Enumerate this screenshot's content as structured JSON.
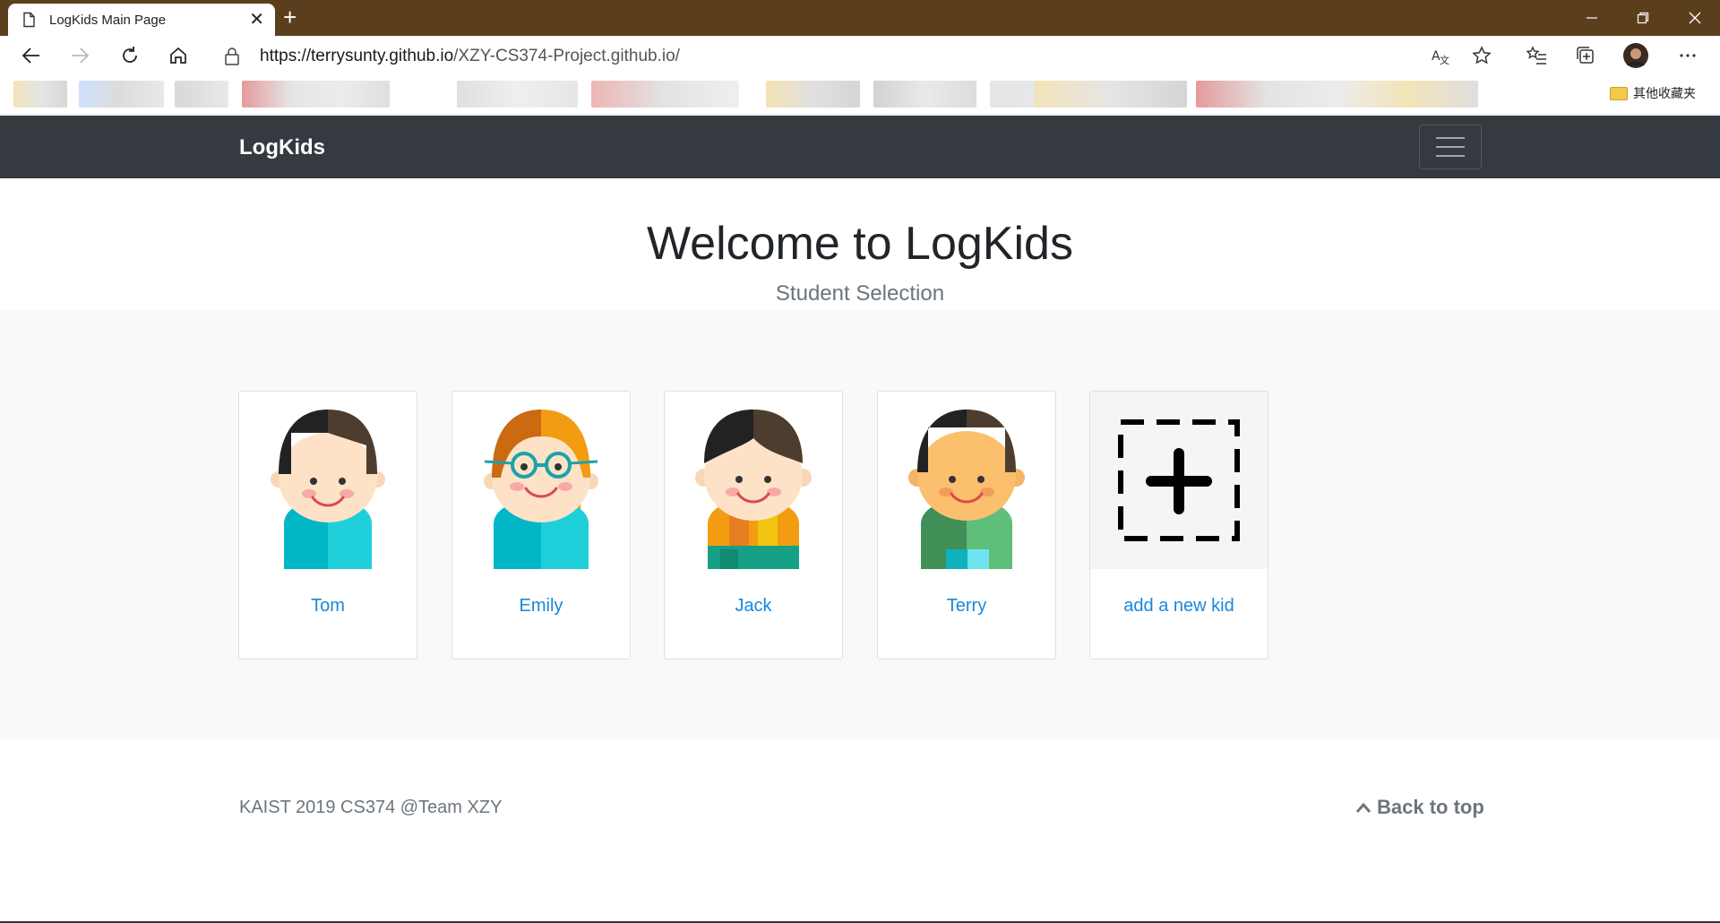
{
  "browser": {
    "tab_title": "LogKids Main Page",
    "url_host": "https://terrysunty.github.io",
    "url_path": "/XZY-CS374-Project.github.io/",
    "other_favorites": "其他收藏夹",
    "icons": [
      "page-icon",
      "close-icon",
      "plus-icon",
      "minimize-icon",
      "restore-icon",
      "close-window-icon",
      "back-icon",
      "forward-icon",
      "refresh-icon",
      "home-icon",
      "lock-icon",
      "translate-icon",
      "star-icon",
      "favorites-icon",
      "collections-icon",
      "avatar",
      "more-icon",
      "folder-icon"
    ]
  },
  "navbar": {
    "brand": "LogKids"
  },
  "hero": {
    "title": "Welcome to LogKids",
    "subtitle": "Student Selection"
  },
  "kids": [
    {
      "name": "Tom"
    },
    {
      "name": "Emily"
    },
    {
      "name": "Jack"
    },
    {
      "name": "Terry"
    },
    {
      "name": "add a new kid"
    }
  ],
  "footer": {
    "copyright": "KAIST 2019 CS374 @Team XZY",
    "back_to_top": "Back to top"
  },
  "colors": {
    "navbar": "#343a40",
    "link": "#1a86d9",
    "titlebar": "#5b3f1d",
    "album_bg": "#f8f9fa"
  }
}
